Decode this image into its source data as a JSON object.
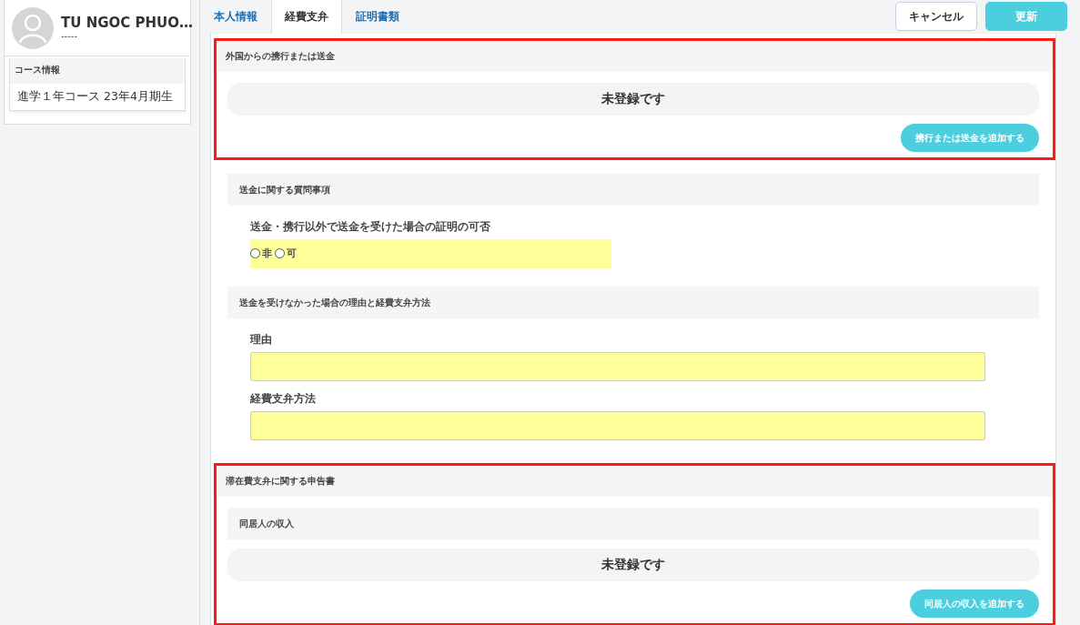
{
  "profile": {
    "name": "TU NGOC PHUO…",
    "subtitle": "-----"
  },
  "course": {
    "heading": "コース情報",
    "value": "進学１年コース 23年4月期生"
  },
  "tabs": [
    {
      "label": "本人情報",
      "selected": false
    },
    {
      "label": "経費支弁",
      "selected": true
    },
    {
      "label": "証明書類",
      "selected": false
    }
  ],
  "actions": [
    {
      "label": "キャンセル",
      "kind": "secondary"
    },
    {
      "label": "更新",
      "kind": "primary"
    }
  ],
  "sections": [
    {
      "title": "外国からの携行または送金",
      "highlighted": true,
      "items": [
        {
          "kind": "notice",
          "text": "未登録です"
        },
        {
          "kind": "add",
          "text": "携行または送金を追加する"
        }
      ]
    },
    {
      "highlighted": false,
      "items": [
        {
          "kind": "subheading",
          "text": "送金に関する質問事項"
        },
        {
          "kind": "radio",
          "label": "送金・携行以外で送金を受けた場合の証明の可否",
          "options": [
            {
              "label": "非",
              "selected": false
            },
            {
              "label": "可",
              "selected": false
            }
          ]
        },
        {
          "kind": "subheading",
          "text": "送金を受けなかった場合の理由と経費支弁方法"
        },
        {
          "kind": "field",
          "label": "理由"
        },
        {
          "kind": "field",
          "label": "経費支弁方法"
        }
      ]
    },
    {
      "title": "滞在費支弁に関する申告書",
      "highlighted": true,
      "items": [
        {
          "kind": "subheading",
          "text": "同居人の収入"
        },
        {
          "kind": "notice",
          "text": "未登録です"
        },
        {
          "kind": "add",
          "text": "同居人の収入を追加する"
        }
      ]
    }
  ]
}
